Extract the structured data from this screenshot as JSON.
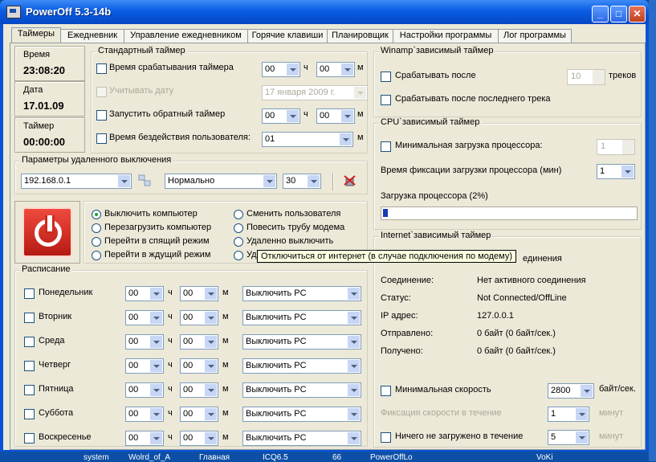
{
  "window": {
    "title": "PowerOff 5.3-14b",
    "min": "_",
    "max": "□",
    "close": "✕"
  },
  "tabs": [
    "Таймеры",
    "Ежедневник",
    "Управление ежедневником",
    "Горячие клавиши",
    "Планировщик",
    "Настройки программы",
    "Лог программы"
  ],
  "status": {
    "time_label": "Время",
    "time": "23:08:20",
    "date_label": "Дата",
    "date": "17.01.09",
    "timer_label": "Таймер",
    "timer": "00:00:00"
  },
  "standard_timer": {
    "title": "Стандартный таймер",
    "fire_time": "Время срабатывания таймера",
    "use_date": "Учитывать дату",
    "date_value": "17   января   2009 г.",
    "countdown": "Запустить обратный таймер",
    "idle": "Время бездействия  пользователя:",
    "hours": "00",
    "minutes": "00",
    "h": "ч",
    "m": "м",
    "idle_value": "01"
  },
  "remote": {
    "title": "Параметры удаленного выключения",
    "ip": "192.168.0.1",
    "mode": "Нормально",
    "number": "30"
  },
  "actions": {
    "shutdown": "Выключить компьютер",
    "reboot": "Перезагрузить компьютер",
    "sleep": "Перейти в спящий режим",
    "standby": "Перейти в ждущий режим",
    "switch_user": "Сменить пользователя",
    "hangup": "Повесить трубу модема",
    "remote_off": "Удаленно выключить",
    "disconnect_partial": "Уд"
  },
  "tooltip": "Отключиться от интернет (в случае подключения по модему)",
  "schedule": {
    "title": "Расписание",
    "days": [
      "Понедельник",
      "Вторник",
      "Среда",
      "Четверг",
      "Пятница",
      "Суббота",
      "Воскресенье"
    ],
    "hours": "00",
    "minutes": "00",
    "h": "ч",
    "m": "м",
    "action": "Выключить PC"
  },
  "winamp": {
    "title": "Winamp`зависимый таймер",
    "after": "Срабатывать после",
    "count": "10",
    "tracks": "треков",
    "after_last": "Срабатывать после последнего трека"
  },
  "cpu": {
    "title": "CPU`зависимый таймер",
    "min_load": "Минимальная загрузка процессора:",
    "min_value": "1",
    "fix_time": "Время фиксации загрузки процессора (мин)",
    "fix_value": "1",
    "load_label": "Загрузка процессора (2%)",
    "load": 0.02
  },
  "internet": {
    "title": "Internet`зависимый таймер",
    "behind_tooltip": "единения",
    "rows": [
      {
        "label": "Соединение:",
        "value": "Нет активного соединения"
      },
      {
        "label": "Статус:",
        "value": "Not Connected/OffLine"
      },
      {
        "label": "IP адрес:",
        "value": "127.0.0.1"
      },
      {
        "label": "Отправлено:",
        "value": "0 байт (0 байт/сек.)"
      },
      {
        "label": "Получено:",
        "value": "0 байт (0 байт/сек.)"
      }
    ],
    "min_speed": "Минимальная скорость",
    "speed_value": "2800",
    "speed_unit": "байт/сек.",
    "fix_speed": "Фиксация скорости в течение",
    "fix_value": "1",
    "minutes": "минут",
    "nothing": "Ничего не загружено в течение",
    "nothing_value": "5"
  },
  "desktop": [
    "system",
    "Wolrd_of_A",
    "Главная",
    "ICQ6.5",
    "66",
    "PowerOffLo",
    "VoKi"
  ]
}
